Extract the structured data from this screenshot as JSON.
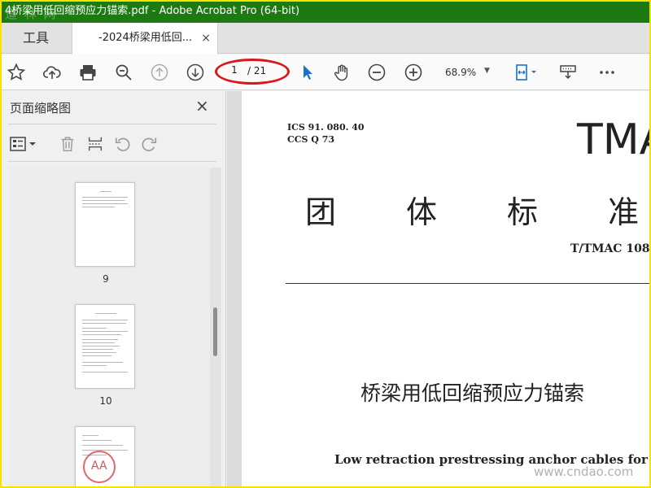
{
  "window": {
    "title": "4桥梁用低回缩预应力锚索.pdf - Adobe Acrobat Pro (64-bit)",
    "watermark_top": "道 林 网",
    "watermark_bottom": "www.cndao.com"
  },
  "tabs": {
    "tools_label": "工具",
    "doc_label": "-2024桥梁用低回...",
    "close_glyph": "×"
  },
  "toolbar": {
    "page_current": "1",
    "page_total": "/ 21",
    "zoom": "68.9%",
    "icons": [
      "star-icon",
      "cloud-upload-icon",
      "print-icon",
      "zoom-out-search-icon",
      "prev-page-icon",
      "next-page-icon",
      "select-cursor-icon",
      "hand-tool-icon",
      "zoom-out-icon",
      "zoom-in-icon",
      "fit-page-icon",
      "comment-tool-icon",
      "more-icon"
    ]
  },
  "panel": {
    "title": "页面缩略图",
    "close_glyph": "×",
    "thumbnails": [
      {
        "label": "9"
      },
      {
        "label": "10"
      },
      {
        "label": ""
      }
    ],
    "stamp_text": "AA"
  },
  "document": {
    "ics": "ICS  91. 080. 40",
    "ccs": "CCS  Q 73",
    "header": "TMA",
    "standard_type": "团体标准",
    "standard_number": "T/TMAC 108",
    "title_cn": "桥梁用低回缩预应力锚索",
    "title_en": "Low retraction prestressing anchor cables for bridge"
  },
  "colors": {
    "titlebar": "#1d7a12",
    "highlight_ring": "#d8181c",
    "frame": "#f5e400",
    "cursor_blue": "#1a6fd1"
  }
}
